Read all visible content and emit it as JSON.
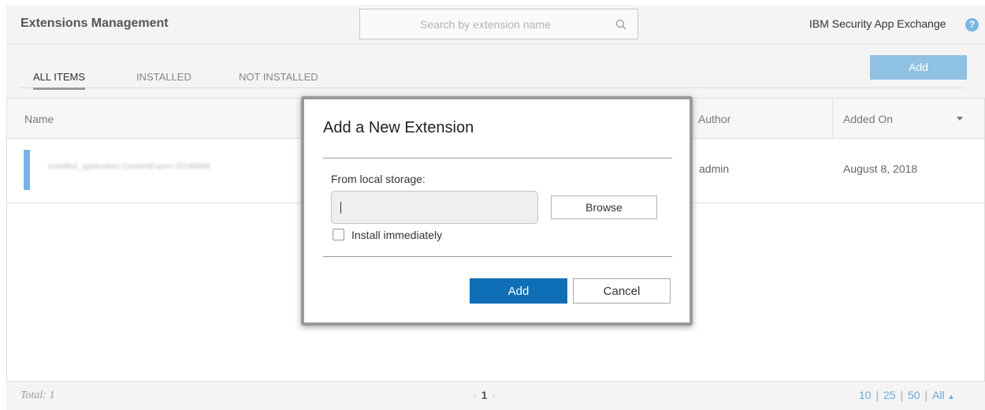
{
  "header": {
    "title": "Extensions Management",
    "search_placeholder": "Search by extension name",
    "brand": "IBM Security App Exchange",
    "help_glyph": "?"
  },
  "tabs": [
    {
      "label": "ALL ITEMS",
      "active": true
    },
    {
      "label": "INSTALLED",
      "active": false
    },
    {
      "label": "NOT INSTALLED",
      "active": false
    }
  ],
  "toolbar": {
    "add_label": "Add"
  },
  "table": {
    "columns": [
      "Name",
      "Author",
      "Added On"
    ],
    "rows": [
      {
        "name": "Installed_application-ContentExport-20180808",
        "author": "admin",
        "added_on": "August 8, 2018"
      }
    ]
  },
  "footer": {
    "total": "Total: 1",
    "current_page": "1",
    "prev_glyph": "‹",
    "next_glyph": "›",
    "page_sizes": [
      "10",
      "25",
      "50",
      "All"
    ],
    "page_size_arrow": "▲"
  },
  "dialog": {
    "title": "Add a New Extension",
    "local_storage_label": "From local storage:",
    "file_value": "",
    "browse_label": "Browse",
    "install_label": "Install immediately",
    "install_checked": false,
    "add_label": "Add",
    "cancel_label": "Cancel"
  },
  "colors": {
    "accent": "#0f6fb6",
    "accent_light": "#8fc1e3",
    "link": "#6aa9d8"
  }
}
